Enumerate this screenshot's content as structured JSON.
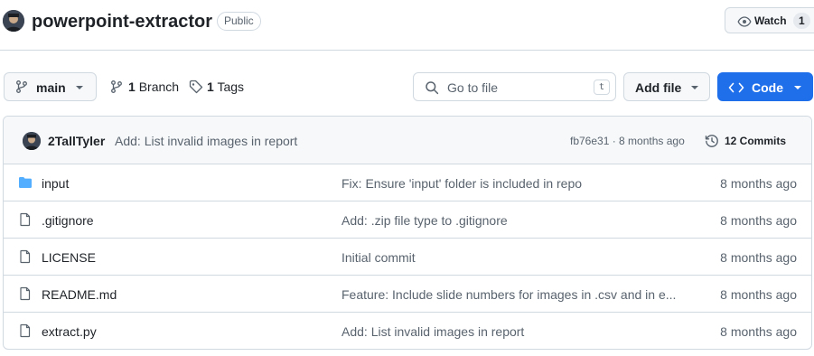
{
  "repo": {
    "name": "powerpoint-extractor",
    "visibility": "Public",
    "watch_label": "Watch",
    "watch_count": "1"
  },
  "toolbar": {
    "branch": "main",
    "branches_count": "1",
    "branches_label": "Branch",
    "tags_count": "1",
    "tags_label": "Tags",
    "search_placeholder": "Go to file",
    "search_shortcut": "t",
    "add_file_label": "Add file",
    "code_label": "Code"
  },
  "latest_commit": {
    "author": "2TallTyler",
    "message": "Add: List invalid images in report",
    "meta": "fb76e31 · 8 months ago",
    "commits": "12 Commits"
  },
  "files": [
    {
      "name": "input",
      "type": "folder",
      "message": "Fix: Ensure 'input' folder is included in repo",
      "age": "8 months ago"
    },
    {
      "name": ".gitignore",
      "type": "file",
      "message": "Add: .zip file type to .gitignore",
      "age": "8 months ago"
    },
    {
      "name": "LICENSE",
      "type": "file",
      "message": "Initial commit",
      "age": "8 months ago"
    },
    {
      "name": "README.md",
      "type": "file",
      "message": "Feature: Include slide numbers for images in .csv and in e...",
      "age": "8 months ago"
    },
    {
      "name": "extract.py",
      "type": "file",
      "message": "Add: List invalid images in report",
      "age": "8 months ago"
    }
  ],
  "colors": {
    "accent_blue": "#1f6feb",
    "folder_blue": "#54aeff",
    "border": "#d1d9e0",
    "muted_text": "#59636e"
  }
}
